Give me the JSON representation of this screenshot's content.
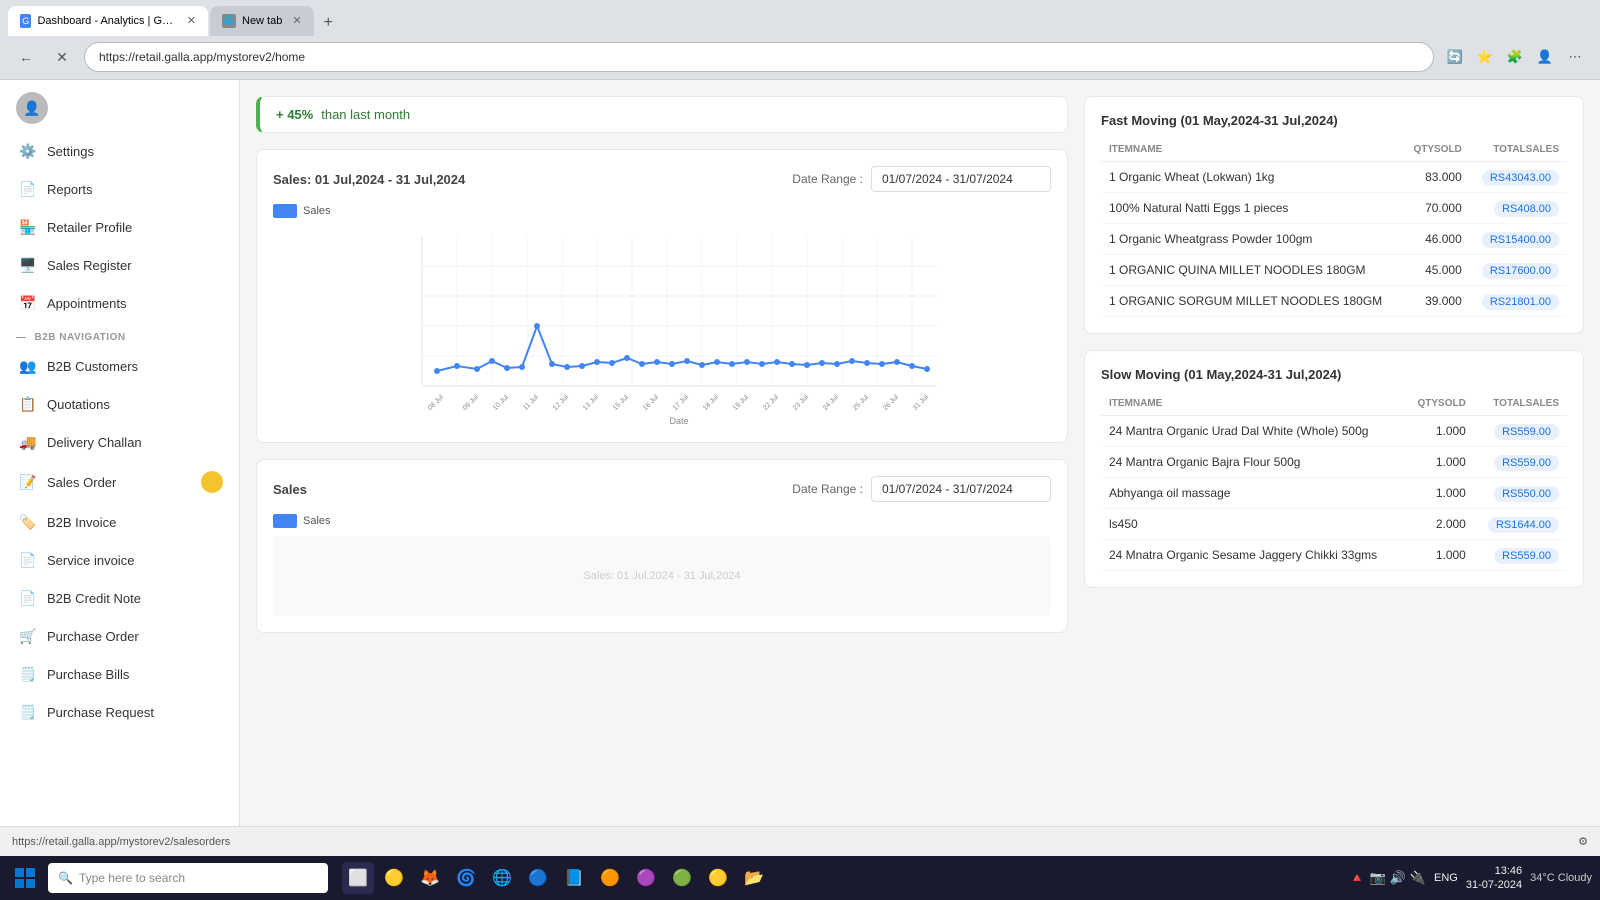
{
  "browser": {
    "tabs": [
      {
        "id": "tab1",
        "title": "Dashboard - Analytics | Galla GS...",
        "active": true,
        "url": "https://retail.galla.app/mystorev2/home"
      },
      {
        "id": "tab2",
        "title": "New tab",
        "active": false,
        "url": ""
      }
    ],
    "address": "https://retail.galla.app/mystorev2/home"
  },
  "sidebar": {
    "user_icon": "👤",
    "settings_label": "Settings",
    "items": [
      {
        "id": "reports",
        "label": "Reports",
        "icon": "📄"
      },
      {
        "id": "retailer-profile",
        "label": "Retailer Profile",
        "icon": "🏪"
      },
      {
        "id": "sales-register",
        "label": "Sales Register",
        "icon": "🖥️"
      },
      {
        "id": "appointments",
        "label": "Appointments",
        "icon": "📅"
      }
    ],
    "b2b_section_label": "B2B NAVIGATION",
    "b2b_items": [
      {
        "id": "b2b-customers",
        "label": "B2B Customers",
        "icon": "👥"
      },
      {
        "id": "quotations",
        "label": "Quotations",
        "icon": "📋"
      },
      {
        "id": "delivery-challan",
        "label": "Delivery Challan",
        "icon": "🚚"
      },
      {
        "id": "sales-order",
        "label": "Sales Order",
        "icon": "📝",
        "badge": true
      },
      {
        "id": "b2b-invoice",
        "label": "B2B Invoice",
        "icon": "🏷️"
      },
      {
        "id": "service-invoice",
        "label": "Service invoice",
        "icon": "📄"
      },
      {
        "id": "b2b-credit-note",
        "label": "B2B Credit Note",
        "icon": "📄"
      },
      {
        "id": "purchase-order",
        "label": "Purchase Order",
        "icon": "🛒"
      },
      {
        "id": "purchase-bills",
        "label": "Purchase Bills",
        "icon": "🗒️"
      },
      {
        "id": "purchase-request",
        "label": "Purchase Request",
        "icon": "🗒️"
      }
    ]
  },
  "top_banner": {
    "text": "+ 45% than last month",
    "accent": "+ 45%"
  },
  "main": {
    "chart1": {
      "title": "Sales: 01 Jul,2024 - 31 Jul,2024",
      "date_range_label": "Date Range :",
      "date_range_value": "01/07/2024 - 31/07/2024",
      "legend": "Sales",
      "x_label": "Date"
    },
    "chart2": {
      "title": "Sales: 01 Jul,2024 - 31 Jul,2024",
      "date_range_label": "Date Range :",
      "date_range_value": "01/07/2024 - 31/07/2024",
      "label": "Sales",
      "subtitle": "Sales"
    }
  },
  "fast_moving": {
    "title": "Fast Moving (01 May,2024-31 Jul,2024)",
    "columns": [
      "ITEMNAME",
      "QTYSOLD",
      "TOTALSALES"
    ],
    "rows": [
      {
        "name": "1 Organic Wheat (Lokwan) 1kg",
        "qty": "83.000",
        "total": "RS43043.00"
      },
      {
        "name": "100% Natural Natti Eggs 1 pieces",
        "qty": "70.000",
        "total": "RS408.00"
      },
      {
        "name": "1 Organic Wheatgrass Powder 100gm",
        "qty": "46.000",
        "total": "RS15400.00"
      },
      {
        "name": "1 ORGANIC QUINA MILLET NOODLES 180GM",
        "qty": "45.000",
        "total": "RS17600.00"
      },
      {
        "name": "1 ORGANIC SORGUM MILLET NOODLES 180GM",
        "qty": "39.000",
        "total": "RS21801.00"
      }
    ]
  },
  "slow_moving": {
    "title": "Slow Moving (01 May,2024-31 Jul,2024)",
    "columns": [
      "ITEMNAME",
      "QTYSOLD",
      "TOTALSALES"
    ],
    "rows": [
      {
        "name": "24 Mantra Organic Urad Dal White (Whole) 500g",
        "qty": "1.000",
        "total": "RS559.00"
      },
      {
        "name": "24 Mantra Organic Bajra Flour 500g",
        "qty": "1.000",
        "total": "RS559.00"
      },
      {
        "name": "Abhyanga oil massage",
        "qty": "1.000",
        "total": "RS550.00"
      },
      {
        "name": "ls450",
        "qty": "2.000",
        "total": "RS1644.00"
      },
      {
        "name": "24 Mnatra Organic Sesame Jaggery Chikki 33gms",
        "qty": "1.000",
        "total": "RS559.00"
      }
    ]
  },
  "taskbar": {
    "search_placeholder": "Type here to search",
    "time": "13:46",
    "date": "31-07-2024",
    "weather": "34°C Cloudy",
    "lang": "ENG"
  },
  "status_bar": {
    "url": "https://retail.galla.app/mystorev2/salesorders"
  }
}
